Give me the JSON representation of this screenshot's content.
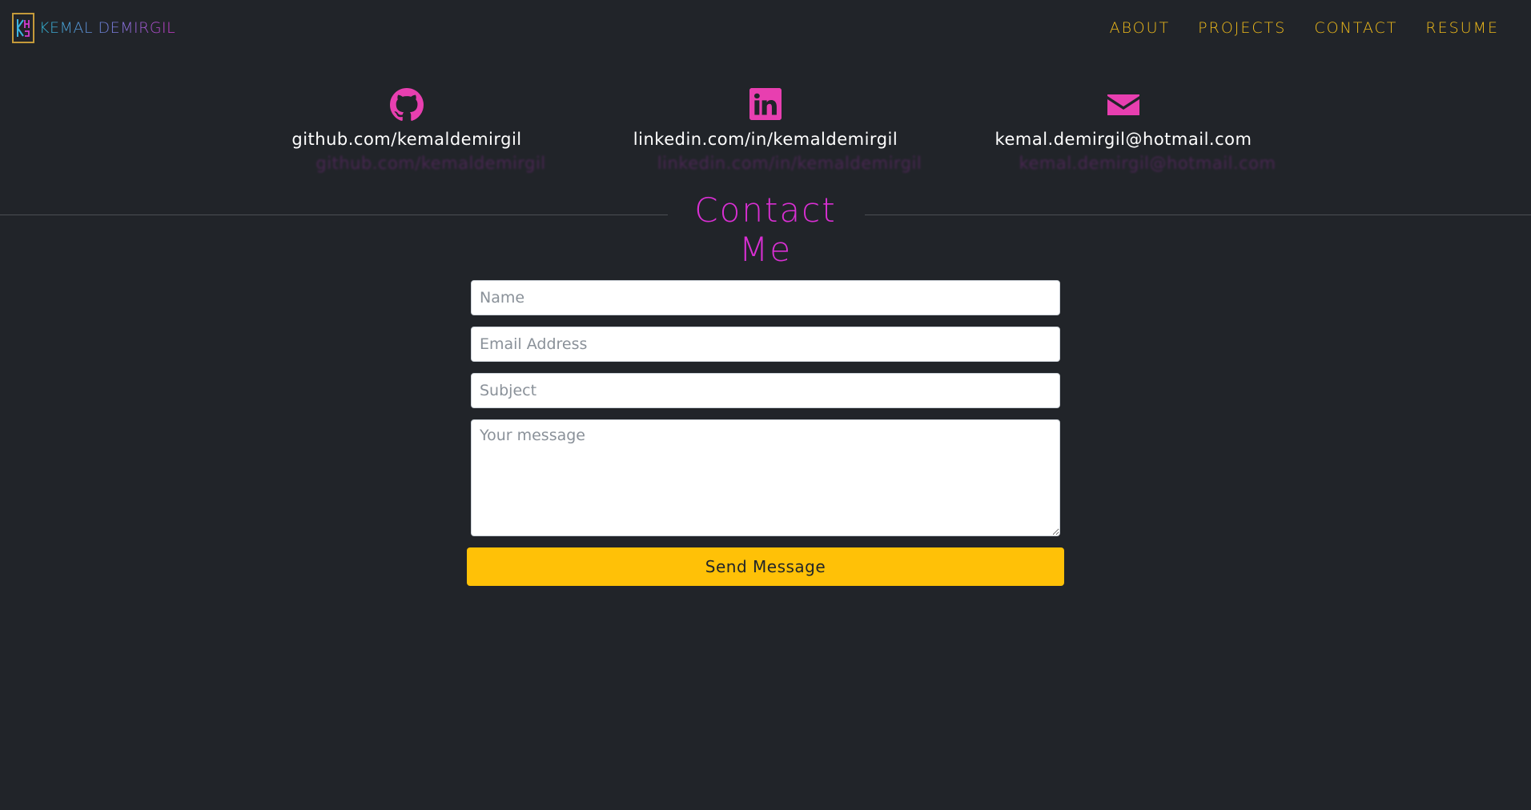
{
  "navbar": {
    "brand": "KEMAL DEMIRGIL",
    "links": [
      "ABOUT",
      "PROJECTS",
      "CONTACT",
      "RESUME"
    ]
  },
  "contacts": {
    "github": {
      "text": "github.com/kemaldemirgil",
      "icon": "github-icon"
    },
    "linkedin": {
      "text": "linkedin.com/in/kemaldemirgil",
      "icon": "linkedin-icon"
    },
    "email": {
      "text": "kemal.demirgil@hotmail.com",
      "icon": "envelope-icon"
    }
  },
  "section": {
    "title": "Contact Me"
  },
  "form": {
    "name_placeholder": "Name",
    "email_placeholder": "Email Address",
    "subject_placeholder": "Subject",
    "message_placeholder": "Your message",
    "send_label": "Send Message"
  },
  "colors": {
    "background": "#212429",
    "accent_pink": "#e83fb0",
    "title_magenta": "#d92fd3",
    "nav_yellow": "#f0bb1a",
    "button_yellow": "#ffc107"
  }
}
